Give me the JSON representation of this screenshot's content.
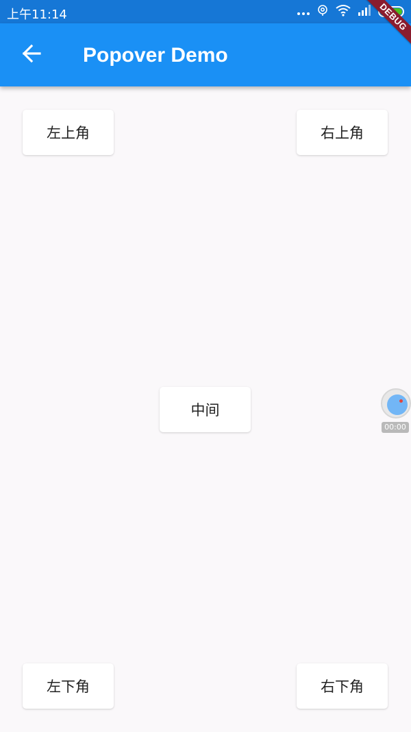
{
  "status_bar": {
    "time": "上午11:14",
    "icons": [
      "more-dots-icon",
      "location-icon",
      "wifi-icon",
      "signal-icon",
      "battery-icon"
    ],
    "battery_color": "#4cc21f"
  },
  "app_bar": {
    "title": "Popover Demo",
    "back_icon": "arrow-left-icon",
    "background": "#1a90f5"
  },
  "debug_banner": "DEBUG",
  "buttons": {
    "top_left": "左上角",
    "top_right": "右上角",
    "center": "中间",
    "bottom_left": "左下角",
    "bottom_right": "右下角"
  },
  "recorder": {
    "time": "00:00"
  }
}
